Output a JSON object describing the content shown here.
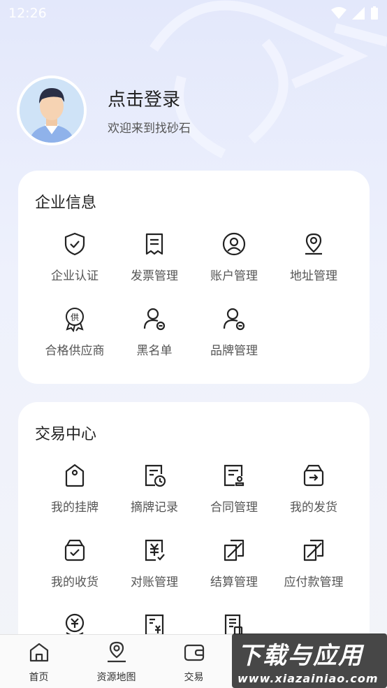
{
  "status_bar": {
    "time": "12:26"
  },
  "profile": {
    "title": "点击登录",
    "subtitle": "欢迎来到找砂石"
  },
  "enterprise": {
    "title": "企业信息",
    "items": [
      {
        "label": "企业认证",
        "icon": "shield-check-icon"
      },
      {
        "label": "发票管理",
        "icon": "receipt-icon"
      },
      {
        "label": "账户管理",
        "icon": "user-circle-icon"
      },
      {
        "label": "地址管理",
        "icon": "map-pin-icon"
      },
      {
        "label": "合格供应商",
        "icon": "supplier-badge-icon"
      },
      {
        "label": "黑名单",
        "icon": "user-block-icon"
      },
      {
        "label": "品牌管理",
        "icon": "user-block-icon"
      }
    ]
  },
  "trade": {
    "title": "交易中心",
    "items": [
      {
        "label": "我的挂牌",
        "icon": "tag-icon"
      },
      {
        "label": "摘牌记录",
        "icon": "clock-doc-icon"
      },
      {
        "label": "合同管理",
        "icon": "contract-icon"
      },
      {
        "label": "我的发货",
        "icon": "ship-box-icon"
      },
      {
        "label": "我的收货",
        "icon": "receive-box-icon"
      },
      {
        "label": "对账管理",
        "icon": "yen-check-icon"
      },
      {
        "label": "结算管理",
        "icon": "pen-doc-icon"
      },
      {
        "label": "应付款管理",
        "icon": "pen-doc-icon"
      }
    ]
  },
  "tabbar": {
    "items": [
      {
        "label": "首页",
        "icon": "home-icon"
      },
      {
        "label": "资源地图",
        "icon": "map-icon"
      },
      {
        "label": "交易",
        "icon": "wallet-icon"
      }
    ]
  },
  "watermark": {
    "main": "下载与应用",
    "url": "www.xiazainiao.com"
  },
  "colors": {
    "background_top": "#e3e8fb",
    "icon_stroke": "#222222",
    "card": "#ffffff"
  }
}
